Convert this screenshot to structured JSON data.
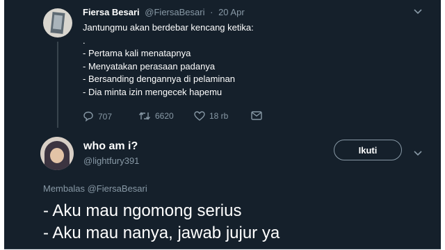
{
  "original_tweet": {
    "display_name": "Fiersa Besari",
    "handle": "@FiersaBesari",
    "separator": "·",
    "date": "20 Apr",
    "text": "Jantungmu akan berdebar kencang ketika:\n.\n- Pertama kali menatapnya\n- Menyatakan perasaan padanya\n- Bersanding dengannya di pelaminan\n- Dia minta izin mengecek hapemu",
    "actions": {
      "replies": "707",
      "retweets": "6620",
      "likes": "18 rb"
    },
    "menu_icon": "chevron-down-icon"
  },
  "reply_tweet": {
    "display_name": "who am i?",
    "handle": "@lightfury391",
    "follow_label": "Ikuti",
    "replying_to_prefix": "Membalas",
    "replying_to_handle": "@FiersaBesari",
    "text": "- Aku mau ngomong serius\n- Aku mau nanya, jawab jujur ya",
    "menu_icon": "chevron-down-icon"
  },
  "colors": {
    "background": "#15202b",
    "text": "#ffffff",
    "secondary_text": "#8899a6",
    "border": "#38444d"
  }
}
